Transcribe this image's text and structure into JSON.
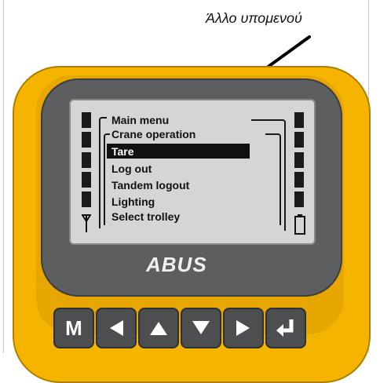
{
  "annotation": {
    "caption": "Άλλο υπομενού"
  },
  "display": {
    "header": "Main menu",
    "submenu_title": "Crane operation",
    "items": [
      {
        "label": "Tare",
        "selected": true
      },
      {
        "label": "Log out",
        "selected": false
      },
      {
        "label": "Tandem logout",
        "selected": false
      },
      {
        "label": "Lighting",
        "selected": false
      },
      {
        "label": "Select trolley",
        "selected": false
      }
    ]
  },
  "device": {
    "brand": "ABUS",
    "body_color": "#f4b400",
    "bezel_color": "#5c5e60",
    "keys": [
      {
        "name": "menu-key",
        "label": "M"
      },
      {
        "name": "left-key",
        "icon": "arrow-left-icon"
      },
      {
        "name": "up-key",
        "icon": "arrow-up-icon"
      },
      {
        "name": "down-key",
        "icon": "arrow-down-icon"
      },
      {
        "name": "right-key",
        "icon": "arrow-right-icon"
      },
      {
        "name": "enter-key",
        "icon": "enter-icon"
      }
    ]
  }
}
